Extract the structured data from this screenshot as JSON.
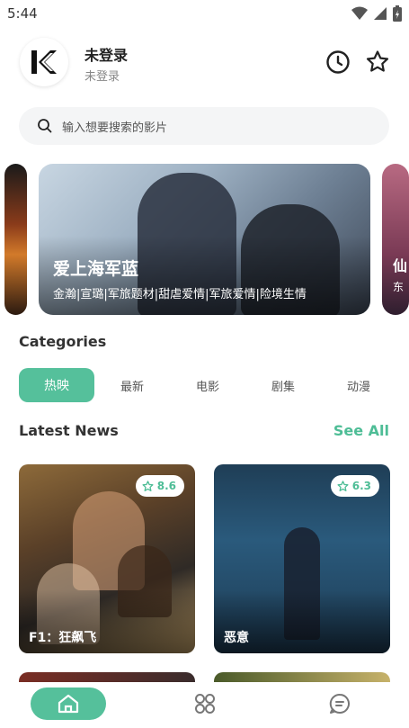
{
  "status": {
    "time": "5:44"
  },
  "user": {
    "name": "未登录",
    "status": "未登录",
    "logo_letter": "K"
  },
  "search": {
    "placeholder": "输入想要搜索的影片"
  },
  "banner": {
    "main": {
      "title": "爱上海军蓝",
      "tags": "金瀚|宣璐|军旅题材|甜虐爱情|军旅爱情|险境生情"
    },
    "right_peek": {
      "title": "仙",
      "subtitle": "东"
    }
  },
  "categories": {
    "title": "Categories",
    "tabs": [
      {
        "label": "热映",
        "active": true
      },
      {
        "label": "最新",
        "active": false
      },
      {
        "label": "电影",
        "active": false
      },
      {
        "label": "剧集",
        "active": false
      },
      {
        "label": "动漫",
        "active": false
      }
    ]
  },
  "latest": {
    "title": "Latest News",
    "see_all": "See All",
    "items": [
      {
        "title": "F1：狂飙飞",
        "rating": "8.6"
      },
      {
        "title": "恶意",
        "rating": "6.3"
      }
    ]
  },
  "colors": {
    "accent": "#55c09b",
    "accent_text": "#4ebd96"
  },
  "icons": [
    "wifi-icon",
    "signal-icon",
    "battery-icon",
    "history-icon",
    "favorite-star-icon",
    "search-icon",
    "star-icon",
    "home-icon",
    "category-icon",
    "message-icon"
  ]
}
